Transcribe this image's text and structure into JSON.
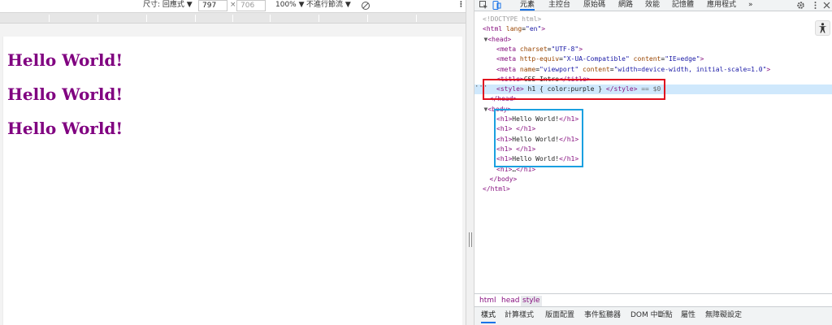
{
  "device_toolbar": {
    "dimensions_label": "尺寸: 回應式 ▼",
    "width_value": "797",
    "times_symbol": "×",
    "height_value": "706",
    "zoom_label": "100% ▼",
    "throttle_label": "不進行節流 ▼",
    "more_label": "⋮"
  },
  "page": {
    "headings": [
      "Hello World!",
      "Hello World!",
      "Hello World!"
    ],
    "heading_color": "#800080"
  },
  "devtools": {
    "tabs": [
      "元素",
      "主控台",
      "原始碼",
      "網路",
      "效能",
      "記憶體",
      "應用程式",
      "»"
    ],
    "active_tab": "元素",
    "dom_lines": [
      {
        "indent": 0,
        "text": "<!DOCTYPE html>",
        "kind": "comment"
      },
      {
        "indent": 0,
        "open": "<html",
        "attrs": [
          {
            "n": "lang",
            "v": "\"en\""
          }
        ],
        "close": ">"
      },
      {
        "indent": 1,
        "arrow": "▼",
        "open": "<head>",
        "attrs": [],
        "close": ""
      },
      {
        "indent": 2,
        "open": "<meta",
        "attrs": [
          {
            "n": "charset",
            "v": "\"UTF-8\""
          }
        ],
        "close": ">"
      },
      {
        "indent": 2,
        "open": "<meta",
        "attrs": [
          {
            "n": "http-equiv",
            "v": "\"X-UA-Compatible\""
          },
          {
            "n": "content",
            "v": "\"IE=edge\""
          }
        ],
        "close": ">"
      },
      {
        "indent": 2,
        "open": "<meta",
        "attrs": [
          {
            "n": "name",
            "v": "\"viewport\""
          },
          {
            "n": "content",
            "v": "\"width=device-width, initial-scale=1.0\""
          }
        ],
        "close": ">"
      },
      {
        "indent": 2,
        "open": "<title>",
        "text": "CSS Intro",
        "close": "</title>"
      },
      {
        "indent": 2,
        "open": "<style>",
        "text": " h1 { color:purple } ",
        "close": "</style>",
        "suffix": " == $0",
        "selected": true
      },
      {
        "indent": 1,
        "open": "</head>",
        "attrs": [],
        "close": ""
      },
      {
        "indent": 1,
        "arrow": "▼",
        "open": "<body>",
        "attrs": [],
        "close": ""
      },
      {
        "indent": 2,
        "open": "<h1>",
        "text": "Hello World!",
        "close": "</h1>"
      },
      {
        "indent": 2,
        "open": "<h1>",
        "text": " ",
        "close": "</h1>"
      },
      {
        "indent": 2,
        "open": "<h1>",
        "text": "Hello World!",
        "close": "</h1>"
      },
      {
        "indent": 2,
        "open": "<h1>",
        "text": " ",
        "close": "</h1>"
      },
      {
        "indent": 2,
        "open": "<h1>",
        "text": "Hello World!",
        "close": "</h1>"
      },
      {
        "indent": 2,
        "open": "<h1>",
        "text": "…",
        "close": "</h1>"
      },
      {
        "indent": 1,
        "open": "</body>",
        "attrs": [],
        "close": ""
      },
      {
        "indent": 0,
        "open": "</html>",
        "attrs": [],
        "close": ""
      }
    ],
    "breadcrumbs": [
      "html",
      "head",
      "style"
    ],
    "active_breadcrumb": "style",
    "styles_tabs": [
      "樣式",
      "計算樣式",
      "版面配置",
      "事件監聽器",
      "DOM 中斷點",
      "屬性",
      "無障礙設定"
    ],
    "active_styles_tab": "樣式"
  },
  "colors": {
    "accent": "#1a73e8",
    "highlight_red": "#e0101e",
    "highlight_blue": "#1aa0e0",
    "selected_row": "#cfe8fc",
    "tag": "#881280",
    "attr_name": "#994500",
    "attr_value": "#1a1aa6"
  }
}
